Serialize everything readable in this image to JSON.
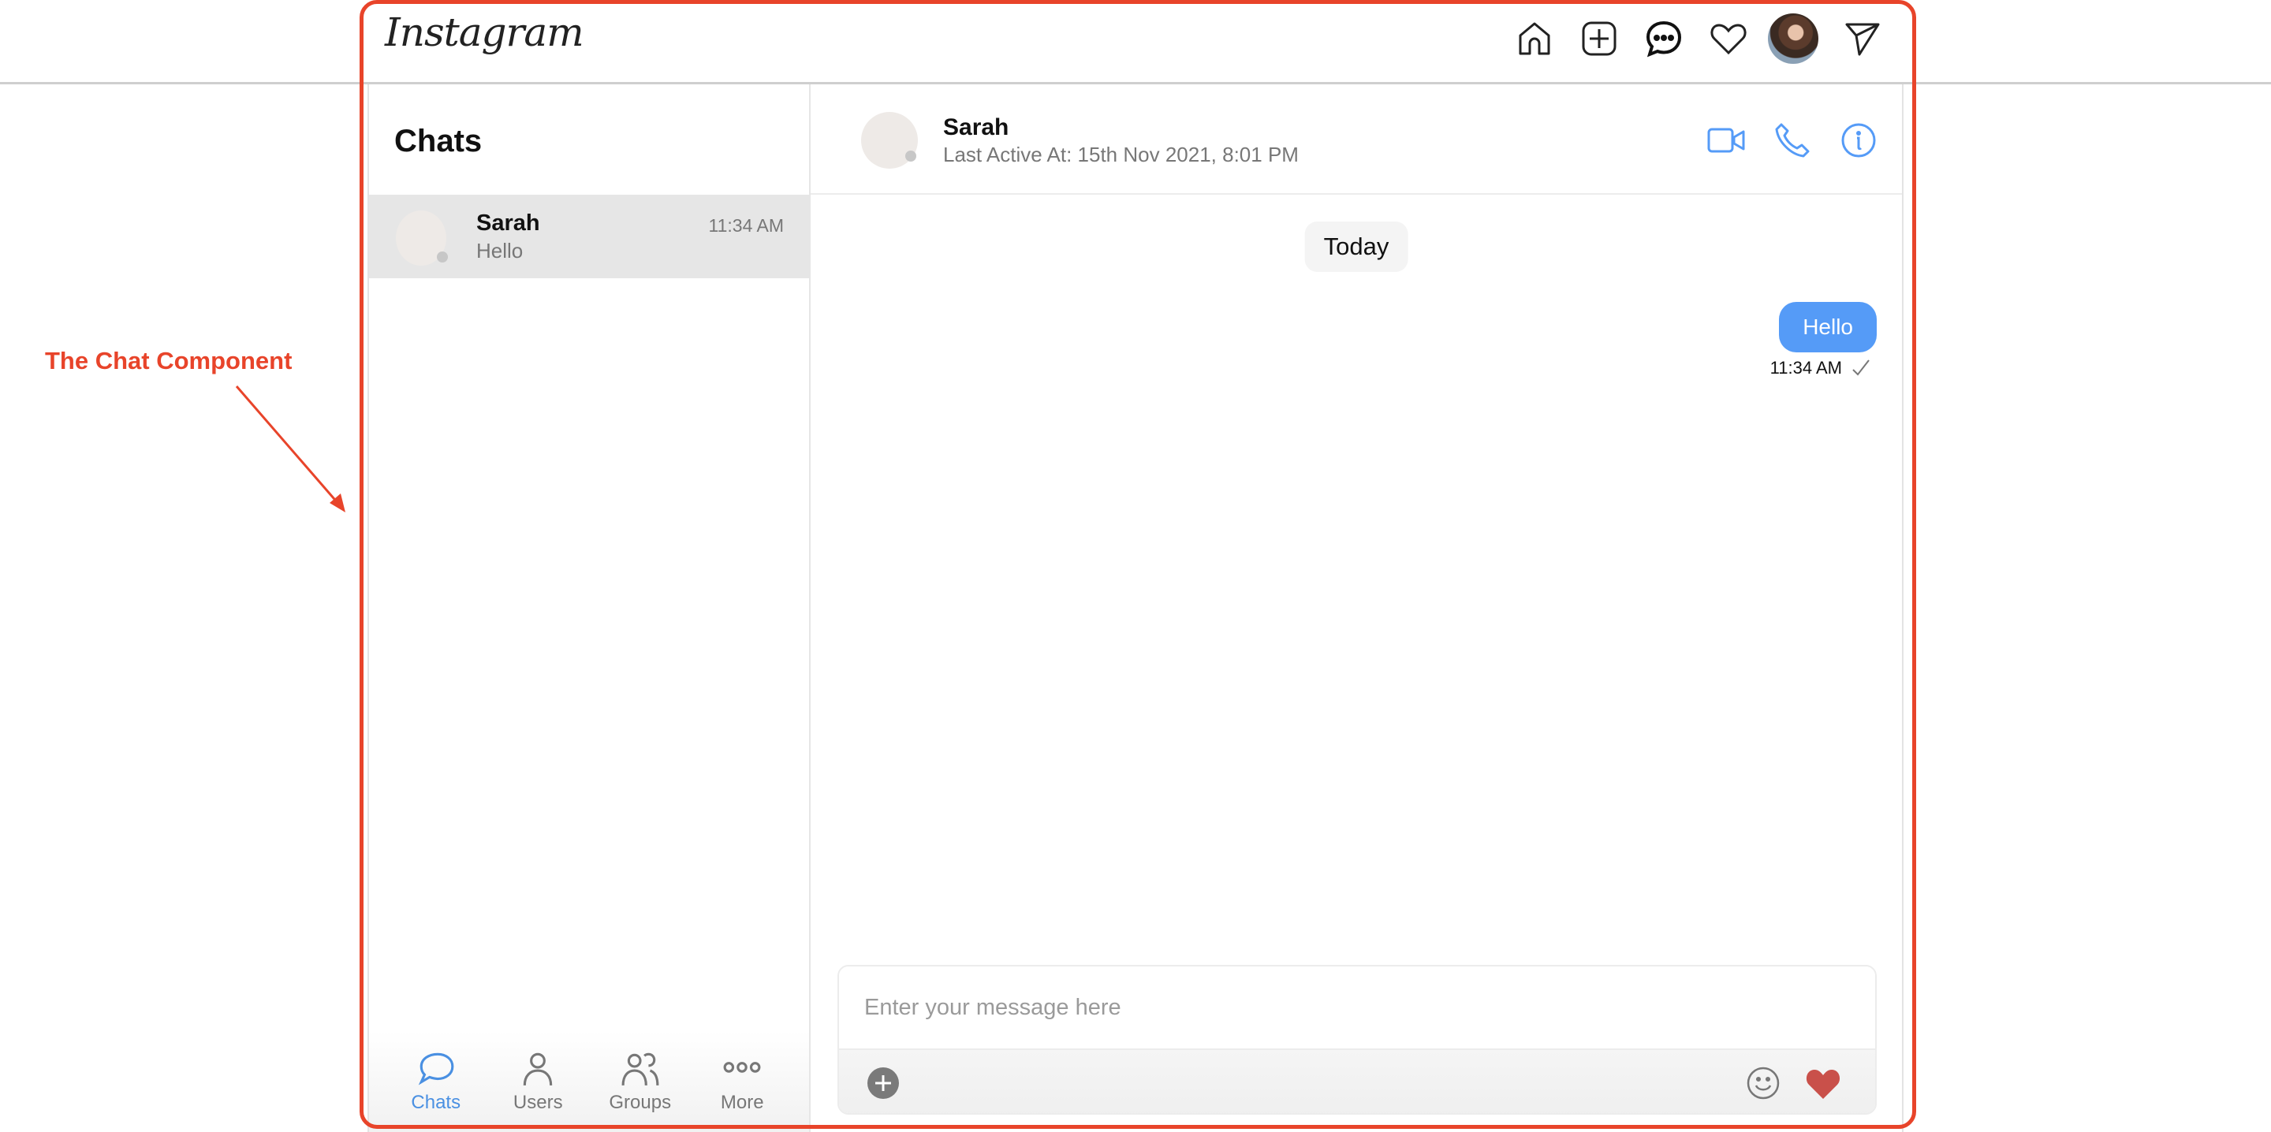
{
  "topbar": {
    "logo": "Instagram",
    "icons": [
      "home-icon",
      "new-post-icon",
      "messages-icon",
      "activity-heart-icon",
      "profile-avatar",
      "direct-send-icon"
    ]
  },
  "sidebar": {
    "title": "Chats",
    "chats": [
      {
        "name": "Sarah",
        "last_message": "Hello",
        "time": "11:34 AM"
      }
    ],
    "tabs": [
      {
        "label": "Chats",
        "icon": "chat-bubble-icon",
        "active": true
      },
      {
        "label": "Users",
        "icon": "user-icon",
        "active": false
      },
      {
        "label": "Groups",
        "icon": "group-icon",
        "active": false
      },
      {
        "label": "More",
        "icon": "more-dots-icon",
        "active": false
      }
    ]
  },
  "conversation": {
    "name": "Sarah",
    "status": "Last Active At: 15th Nov 2021, 8:01 PM",
    "actions": [
      "video-call-icon",
      "phone-call-icon",
      "info-icon"
    ],
    "date_separator": "Today",
    "messages": [
      {
        "direction": "outgoing",
        "text": "Hello",
        "time": "11:34 AM",
        "status": "sent"
      }
    ],
    "composer": {
      "placeholder": "Enter your message here",
      "value": ""
    }
  },
  "annotation": {
    "label": "The Chat Component"
  },
  "colors": {
    "accent": "#559bf7",
    "annotation": "#e8442a",
    "like_heart": "#c9504a"
  }
}
